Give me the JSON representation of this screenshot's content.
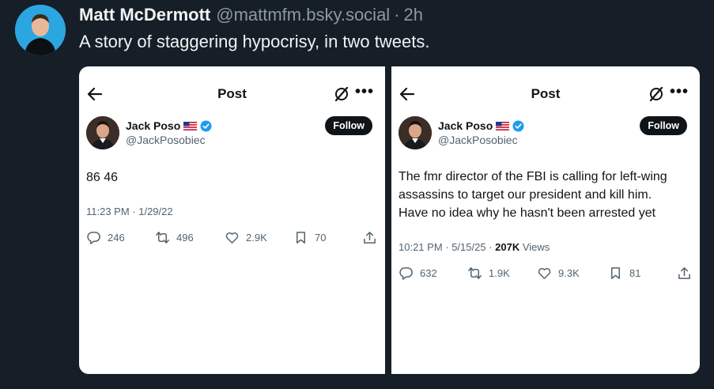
{
  "post": {
    "author_name": "Matt McDermott",
    "author_handle": "@mattmfm.bsky.social",
    "separator": "·",
    "time": "2h",
    "text": "A story of staggering hypocrisy, in two tweets."
  },
  "embedded_tweets": [
    {
      "nav_title": "Post",
      "nav_more": "•••",
      "name": "Jack Poso",
      "handle": "@JackPosobiec",
      "follow_label": "Follow",
      "body": "86 46",
      "timestamp": "11:23 PM · 1/29/22",
      "replies": "246",
      "reposts": "496",
      "likes": "2.9K",
      "bookmarks": "70"
    },
    {
      "nav_title": "Post",
      "nav_more": "•••",
      "name": "Jack Poso",
      "handle": "@JackPosobiec",
      "follow_label": "Follow",
      "body": "The fmr director of the FBI is calling for left-wing\nassassins to target our president and kill him.\nHave no idea why he hasn't been arrested yet",
      "timestamp": "10:21 PM · 5/15/25 · ",
      "views_count": "207K",
      "views_label": " Views",
      "replies": "632",
      "reposts": "1.9K",
      "likes": "9.3K",
      "bookmarks": "81"
    }
  ],
  "icons": {
    "back": "arrow-left-icon",
    "grok": "grok-icon",
    "more": "more-icon",
    "flag": "us-flag-icon",
    "verified": "verified-badge-icon",
    "reply": "reply-icon",
    "repost": "repost-icon",
    "like": "like-icon",
    "bookmark": "bookmark-icon",
    "share": "share-icon"
  },
  "colors": {
    "background": "#161e27",
    "text_primary": "#f1f3f5",
    "text_secondary": "#8c98a6",
    "verified_blue": "#1d9bf0",
    "follow_button": "#0f1419"
  }
}
